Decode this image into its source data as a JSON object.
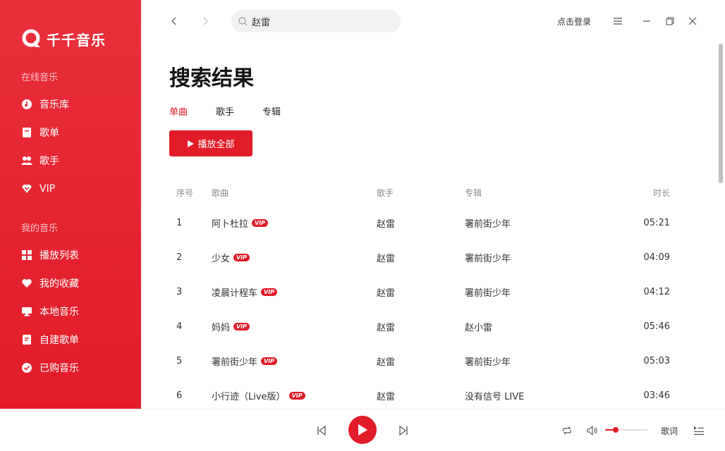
{
  "app": {
    "name": "千千音乐",
    "brand_color": "#e21c29"
  },
  "sidebar": {
    "online_title": "在线音乐",
    "online_items": [
      {
        "label": "音乐库",
        "icon": "music-disc-icon"
      },
      {
        "label": "歌单",
        "icon": "playlist-doc-icon"
      },
      {
        "label": "歌手",
        "icon": "users-icon"
      },
      {
        "label": "VIP",
        "icon": "diamond-icon"
      }
    ],
    "mine_title": "我的音乐",
    "mine_items": [
      {
        "label": "播放列表",
        "icon": "grid-icon"
      },
      {
        "label": "我的收藏",
        "icon": "heart-icon"
      },
      {
        "label": "本地音乐",
        "icon": "monitor-icon"
      },
      {
        "label": "自建歌单",
        "icon": "doc-icon"
      },
      {
        "label": "已购音乐",
        "icon": "check-circle-icon"
      }
    ]
  },
  "topbar": {
    "search_value": "赵雷",
    "login_label": "点击登录"
  },
  "main": {
    "title": "搜索结果",
    "tabs": [
      "单曲",
      "歌手",
      "专辑"
    ],
    "active_tab": 0,
    "play_all_label": "播放全部",
    "columns": {
      "index": "序号",
      "song": "歌曲",
      "artist": "歌手",
      "album": "专辑",
      "duration": "时长"
    },
    "rows": [
      {
        "index": "1",
        "song": "阿卜杜拉",
        "vip": "VIP",
        "artist": "赵雷",
        "album": "署前街少年",
        "duration": "05:21"
      },
      {
        "index": "2",
        "song": "少女",
        "vip": "VIP",
        "artist": "赵雷",
        "album": "署前街少年",
        "duration": "04:09"
      },
      {
        "index": "3",
        "song": "凌晨计程车",
        "vip": "VIP",
        "artist": "赵雷",
        "album": "署前街少年",
        "duration": "04:12"
      },
      {
        "index": "4",
        "song": "妈妈",
        "vip": "VIP",
        "artist": "赵雷",
        "album": "赵小雷",
        "duration": "05:46"
      },
      {
        "index": "5",
        "song": "署前街少年",
        "vip": "VIP",
        "artist": "赵雷",
        "album": "署前街少年",
        "duration": "05:03"
      },
      {
        "index": "6",
        "song": "小行迹（Live版）",
        "vip": "VIP",
        "artist": "赵雷",
        "album": "没有信号 LIVE",
        "duration": "03:46"
      }
    ]
  },
  "player": {
    "lyrics_label": "歌词",
    "volume": 0.25
  }
}
